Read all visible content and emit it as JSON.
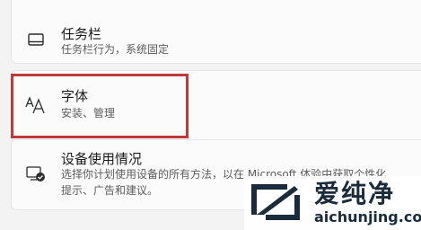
{
  "items": [
    {
      "title": "任务栏",
      "subtitle": "任务栏行为，系统固定",
      "icon": "taskbar-icon",
      "chevron": "›"
    },
    {
      "title": "字体",
      "subtitle": "安装、管理",
      "icon": "font-icon",
      "chevron": "›"
    },
    {
      "title": "设备使用情况",
      "subtitle_line1": "选择你计划使用设备的所有方法，以在 Microsoft 体验中获取个性化",
      "subtitle_line2": "提示、广告和建议。",
      "icon": "device-usage-icon",
      "chevron": "›"
    }
  ],
  "highlight_color": "#c0393b",
  "watermark": {
    "name": "爱纯净",
    "url": "aichunjing.com"
  }
}
